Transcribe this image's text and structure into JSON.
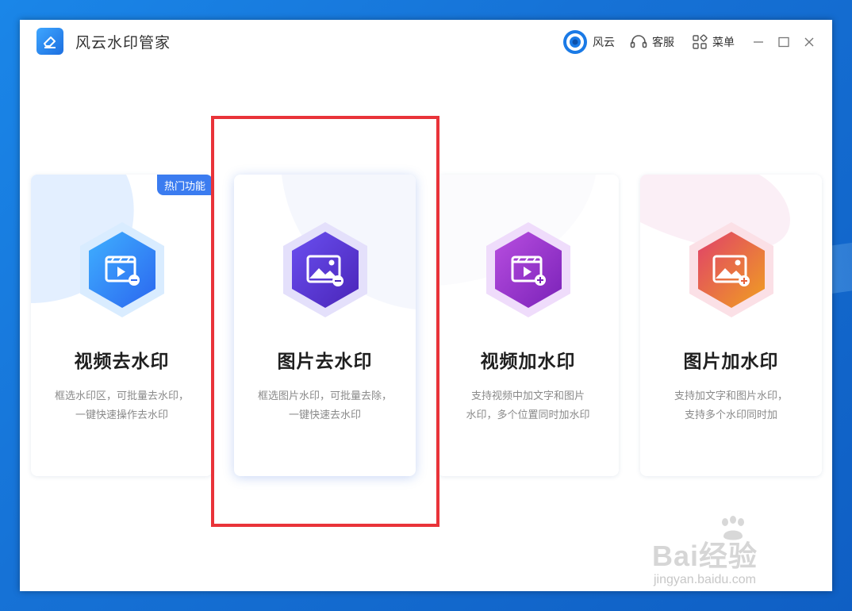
{
  "window": {
    "app_title": "风云水印管家",
    "toolbar": {
      "account_label": "风云",
      "service_label": "客服",
      "menu_label": "菜单"
    }
  },
  "cards": [
    {
      "title": "视频去水印",
      "desc_line1": "框选水印区，可批量去水印，",
      "desc_line2": "一键快速操作去水印",
      "badge": "热门功能",
      "icon": "video-remove-icon",
      "accent": "#2f8cf0"
    },
    {
      "title": "图片去水印",
      "desc_line1": "框选图片水印，可批量去除，",
      "desc_line2": "一键快速去水印",
      "icon": "image-remove-icon",
      "accent": "#5a3fd8"
    },
    {
      "title": "视频加水印",
      "desc_line1": "支持视频中加文字和图片",
      "desc_line2": "水印，多个位置同时加水印",
      "icon": "video-add-icon",
      "accent": "#9c3fd8"
    },
    {
      "title": "图片加水印",
      "desc_line1": "支持加文字和图片水印，",
      "desc_line2": "支持多个水印同时加",
      "icon": "image-add-icon",
      "accent": "#e8623a"
    }
  ],
  "watermark": {
    "brand": "Bai经验",
    "url": "jingyan.baidu.com"
  },
  "colors": {
    "highlight_border": "#e93339",
    "badge_bg": "#3b7cf0"
  }
}
